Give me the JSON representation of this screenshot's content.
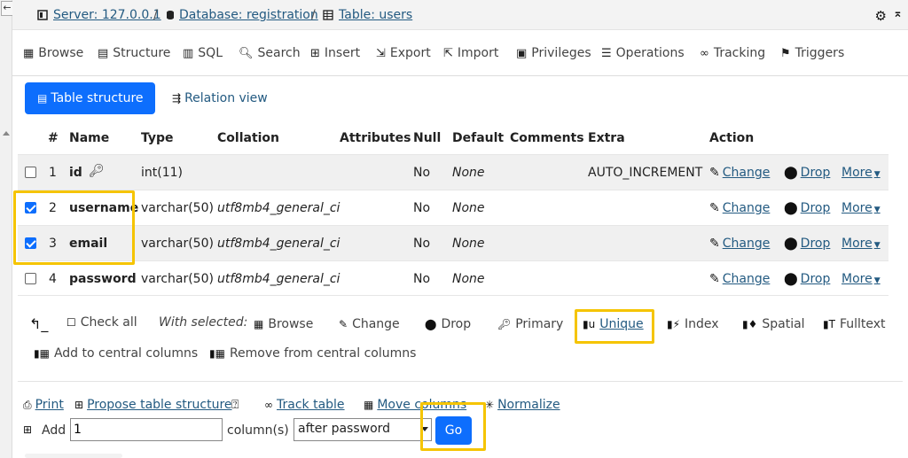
{
  "breadcrumb": {
    "server": "Server: 127.0.0.1",
    "database": "Database: registration",
    "table": "Table: users",
    "separator": "/"
  },
  "tabs": [
    {
      "label": "Browse",
      "icon": "table-icon"
    },
    {
      "label": "Structure",
      "icon": "structure-icon"
    },
    {
      "label": "SQL",
      "icon": "sql-icon"
    },
    {
      "label": "Search",
      "icon": "search-icon"
    },
    {
      "label": "Insert",
      "icon": "insert-icon"
    },
    {
      "label": "Export",
      "icon": "export-icon"
    },
    {
      "label": "Import",
      "icon": "import-icon"
    },
    {
      "label": "Privileges",
      "icon": "privileges-icon"
    },
    {
      "label": "Operations",
      "icon": "operations-icon"
    },
    {
      "label": "Tracking",
      "icon": "tracking-icon"
    },
    {
      "label": "Triggers",
      "icon": "triggers-icon"
    }
  ],
  "subnav": {
    "table_structure": "Table structure",
    "relation_view": "Relation view"
  },
  "columns": {
    "hash": "#",
    "name": "Name",
    "type": "Type",
    "collation": "Collation",
    "attributes": "Attributes",
    "null": "Null",
    "default": "Default",
    "comments": "Comments",
    "extra": "Extra",
    "action": "Action"
  },
  "rows": [
    {
      "num": "1",
      "name": "id",
      "type": "int(11)",
      "collation": "",
      "null": "No",
      "default": "None",
      "extra": "AUTO_INCREMENT",
      "checked": false,
      "primary_key": true
    },
    {
      "num": "2",
      "name": "username",
      "type": "varchar(50)",
      "collation": "utf8mb4_general_ci",
      "null": "No",
      "default": "None",
      "extra": "",
      "checked": true,
      "primary_key": false
    },
    {
      "num": "3",
      "name": "email",
      "type": "varchar(50)",
      "collation": "utf8mb4_general_ci",
      "null": "No",
      "default": "None",
      "extra": "",
      "checked": true,
      "primary_key": false
    },
    {
      "num": "4",
      "name": "password",
      "type": "varchar(50)",
      "collation": "utf8mb4_general_ci",
      "null": "No",
      "default": "None",
      "extra": "",
      "checked": false,
      "primary_key": false
    }
  ],
  "row_actions": {
    "change": "Change",
    "drop": "Drop",
    "more": "More"
  },
  "with_selected": {
    "check_all": "Check all",
    "label": "With selected:",
    "browse": "Browse",
    "change": "Change",
    "drop": "Drop",
    "primary": "Primary",
    "unique": "Unique",
    "index": "Index",
    "spatial": "Spatial",
    "fulltext": "Fulltext",
    "add_central": "Add to central columns",
    "remove_central": "Remove from central columns"
  },
  "bottom": {
    "print": "Print",
    "propose": "Propose table structure",
    "track": "Track table",
    "move": "Move columns",
    "normalize": "Normalize",
    "add_label": "Add",
    "add_value": "1",
    "columns_label": "column(s)",
    "position_value": "after password",
    "go": "Go"
  },
  "colors": {
    "accent": "#0d6efd",
    "link": "#235a81",
    "highlight": "#f5c400"
  }
}
